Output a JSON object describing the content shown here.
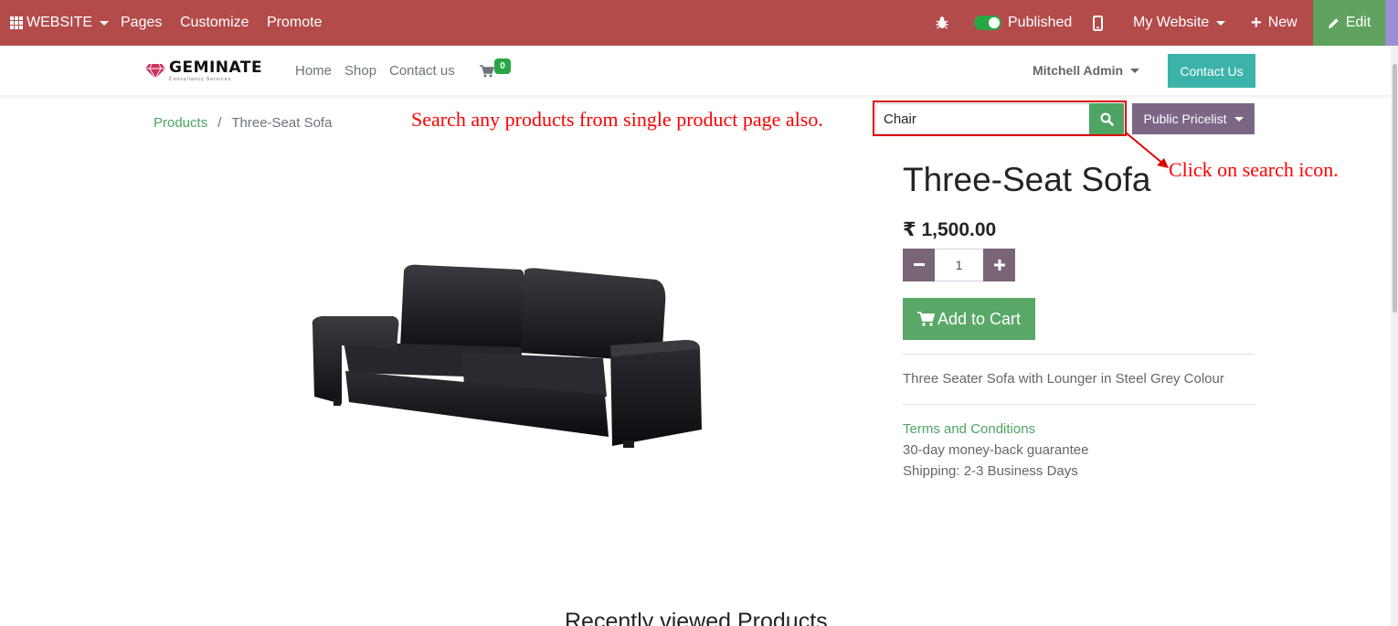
{
  "topbar": {
    "website_label": "WEBSITE",
    "pages_label": "Pages",
    "customize_label": "Customize",
    "promote_label": "Promote",
    "published_label": "Published",
    "my_website_label": "My Website",
    "new_label": "New",
    "edit_label": "Edit"
  },
  "header": {
    "logo_text": "GEMINATE",
    "logo_subtext": "Consultancy Services",
    "nav": [
      "Home",
      "Shop",
      "Contact us"
    ],
    "cart_count": "0",
    "user_name": "Mitchell Admin",
    "contact_button": "Contact Us"
  },
  "breadcrumb": {
    "parent": "Products",
    "separator": "/",
    "current": "Three-Seat Sofa"
  },
  "search": {
    "value": "Chair",
    "pricelist_label": "Public Pricelist"
  },
  "annotations": {
    "search_note": "Search any products from single product page also.",
    "click_note": "Click on search icon."
  },
  "product": {
    "title": "Three-Seat Sofa",
    "price": "₹ 1,500.00",
    "quantity": "1",
    "add_to_cart": "Add to Cart",
    "description": "Three Seater Sofa with Lounger in Steel Grey Colour",
    "terms": "Terms and Conditions",
    "guarantee": "30-day money-back guarantee",
    "shipping": "Shipping: 2-3 Business Days"
  },
  "recent_heading": "Recently viewed Products",
  "colors": {
    "topbar": "#b44b4b",
    "edit": "#5fa35f",
    "accent_green": "#4ea463",
    "teal": "#3cb3a8",
    "purple": "#7c6686",
    "annotation": "#ff0000"
  }
}
